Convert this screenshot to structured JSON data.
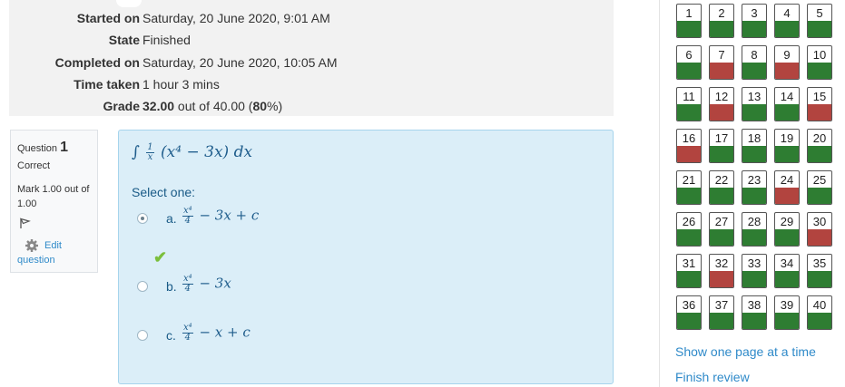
{
  "summary": {
    "rows": [
      {
        "label": "Started on",
        "value": "Saturday, 20 June 2020, 9:01 AM"
      },
      {
        "label": "State",
        "value": "Finished"
      },
      {
        "label": "Completed on",
        "value": "Saturday, 20 June 2020, 10:05 AM"
      },
      {
        "label": "Time taken",
        "value": "1 hour 3 mins"
      }
    ],
    "grade": {
      "label": "Grade",
      "score": "32.00",
      "out_of_text": " out of 40.00 (",
      "percent": "80",
      "close": "%)"
    }
  },
  "question": {
    "prefix": "Question",
    "number": "1",
    "state": "Correct",
    "mark": "Mark 1.00 out of 1.00",
    "edit_1": "Edit",
    "edit_2": "question",
    "text": {
      "integral": "∫",
      "frac_top": "1",
      "frac_bottom": "x",
      "body": "(x⁴ − 3x) dx"
    },
    "prompt": "Select one:",
    "answers": [
      {
        "letter": "a.",
        "frac_top": "x⁴",
        "frac_bottom": "4",
        "rest": "− 3x + c",
        "checked": true
      },
      {
        "letter": "b.",
        "frac_top": "x⁴",
        "frac_bottom": "4",
        "rest": "− 3x",
        "checked": false
      },
      {
        "letter": "c.",
        "frac_top": "x⁴",
        "frac_bottom": "4",
        "rest": "− x + c",
        "checked": false
      }
    ]
  },
  "navigation": {
    "buttons": [
      {
        "n": "1",
        "status": "correct"
      },
      {
        "n": "2",
        "status": "correct"
      },
      {
        "n": "3",
        "status": "correct"
      },
      {
        "n": "4",
        "status": "correct"
      },
      {
        "n": "5",
        "status": "correct"
      },
      {
        "n": "6",
        "status": "correct"
      },
      {
        "n": "7",
        "status": "incorrect"
      },
      {
        "n": "8",
        "status": "correct"
      },
      {
        "n": "9",
        "status": "incorrect"
      },
      {
        "n": "10",
        "status": "correct"
      },
      {
        "n": "11",
        "status": "correct"
      },
      {
        "n": "12",
        "status": "incorrect"
      },
      {
        "n": "13",
        "status": "correct"
      },
      {
        "n": "14",
        "status": "correct"
      },
      {
        "n": "15",
        "status": "incorrect"
      },
      {
        "n": "16",
        "status": "incorrect"
      },
      {
        "n": "17",
        "status": "correct"
      },
      {
        "n": "18",
        "status": "correct"
      },
      {
        "n": "19",
        "status": "correct"
      },
      {
        "n": "20",
        "status": "correct"
      },
      {
        "n": "21",
        "status": "correct"
      },
      {
        "n": "22",
        "status": "correct"
      },
      {
        "n": "23",
        "status": "correct"
      },
      {
        "n": "24",
        "status": "incorrect"
      },
      {
        "n": "25",
        "status": "correct"
      },
      {
        "n": "26",
        "status": "correct"
      },
      {
        "n": "27",
        "status": "correct"
      },
      {
        "n": "28",
        "status": "correct"
      },
      {
        "n": "29",
        "status": "correct"
      },
      {
        "n": "30",
        "status": "incorrect"
      },
      {
        "n": "31",
        "status": "correct"
      },
      {
        "n": "32",
        "status": "incorrect"
      },
      {
        "n": "33",
        "status": "correct"
      },
      {
        "n": "34",
        "status": "correct"
      },
      {
        "n": "35",
        "status": "correct"
      },
      {
        "n": "36",
        "status": "correct"
      },
      {
        "n": "37",
        "status": "correct"
      },
      {
        "n": "38",
        "status": "correct"
      },
      {
        "n": "39",
        "status": "correct"
      },
      {
        "n": "40",
        "status": "correct"
      }
    ],
    "show_one_page": "Show one page at a time",
    "finish_review": "Finish review"
  },
  "colors": {
    "correct": "#2e7d32",
    "incorrect": "#b2443f",
    "link": "#2f8ac9",
    "check": "#7bbf3c"
  },
  "icons": [
    "radio-selected-icon",
    "radio-icon",
    "checkmark-icon",
    "flag-icon",
    "gear-icon"
  ]
}
